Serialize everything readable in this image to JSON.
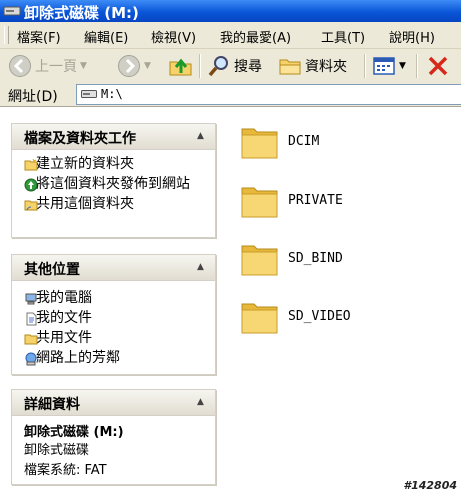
{
  "window": {
    "title": "卸除式磁碟 (M:)"
  },
  "menu": [
    "檔案(F)",
    "編輯(E)",
    "檢視(V)",
    "我的最愛(A)",
    "工具(T)",
    "說明(H)"
  ],
  "toolbar": {
    "back_label": "上一頁",
    "search_label": "搜尋",
    "folders_label": "資料夾"
  },
  "address": {
    "label": "網址(D)",
    "value": "M:\\"
  },
  "file_tasks": {
    "title": "檔案及資料夾工作",
    "items": [
      "建立新的資料夾",
      "將這個資料夾發佈到網站",
      "共用這個資料夾"
    ]
  },
  "other_places": {
    "title": "其他位置",
    "items": [
      "我的電腦",
      "我的文件",
      "共用文件",
      "網路上的芳鄰"
    ]
  },
  "details": {
    "title": "詳細資料",
    "name": "卸除式磁碟 (M:)",
    "type": "卸除式磁碟",
    "filesystem": "檔案系統: FAT"
  },
  "folders": [
    "DCIM",
    "PRIVATE",
    "SD_BIND",
    "SD_VIDEO"
  ],
  "watermark": "#142804",
  "colors": {
    "titlebar": "#0a56d8",
    "chrome": "#ece9d8",
    "folder": "#f7d774"
  }
}
